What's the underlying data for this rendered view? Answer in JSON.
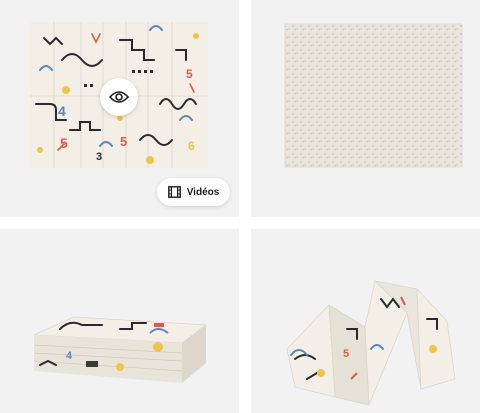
{
  "gallery": {
    "images": [
      {
        "name": "Playmat unfolded - front pattern"
      },
      {
        "name": "Playmat unfolded - back texture"
      },
      {
        "name": "Playmat folded flat"
      },
      {
        "name": "Playmat standing folded"
      }
    ],
    "view_button": {
      "icon": "eye-icon"
    },
    "videos_button": {
      "icon": "film-icon",
      "label": "Vidéos"
    }
  },
  "colors": {
    "tile_background": "#f2f2f2",
    "mat_background": "#f3efe6",
    "accent_red": "#e0584a",
    "accent_yellow": "#f0c44a",
    "accent_blue": "#5b86b8",
    "accent_black": "#2a2a2a"
  }
}
